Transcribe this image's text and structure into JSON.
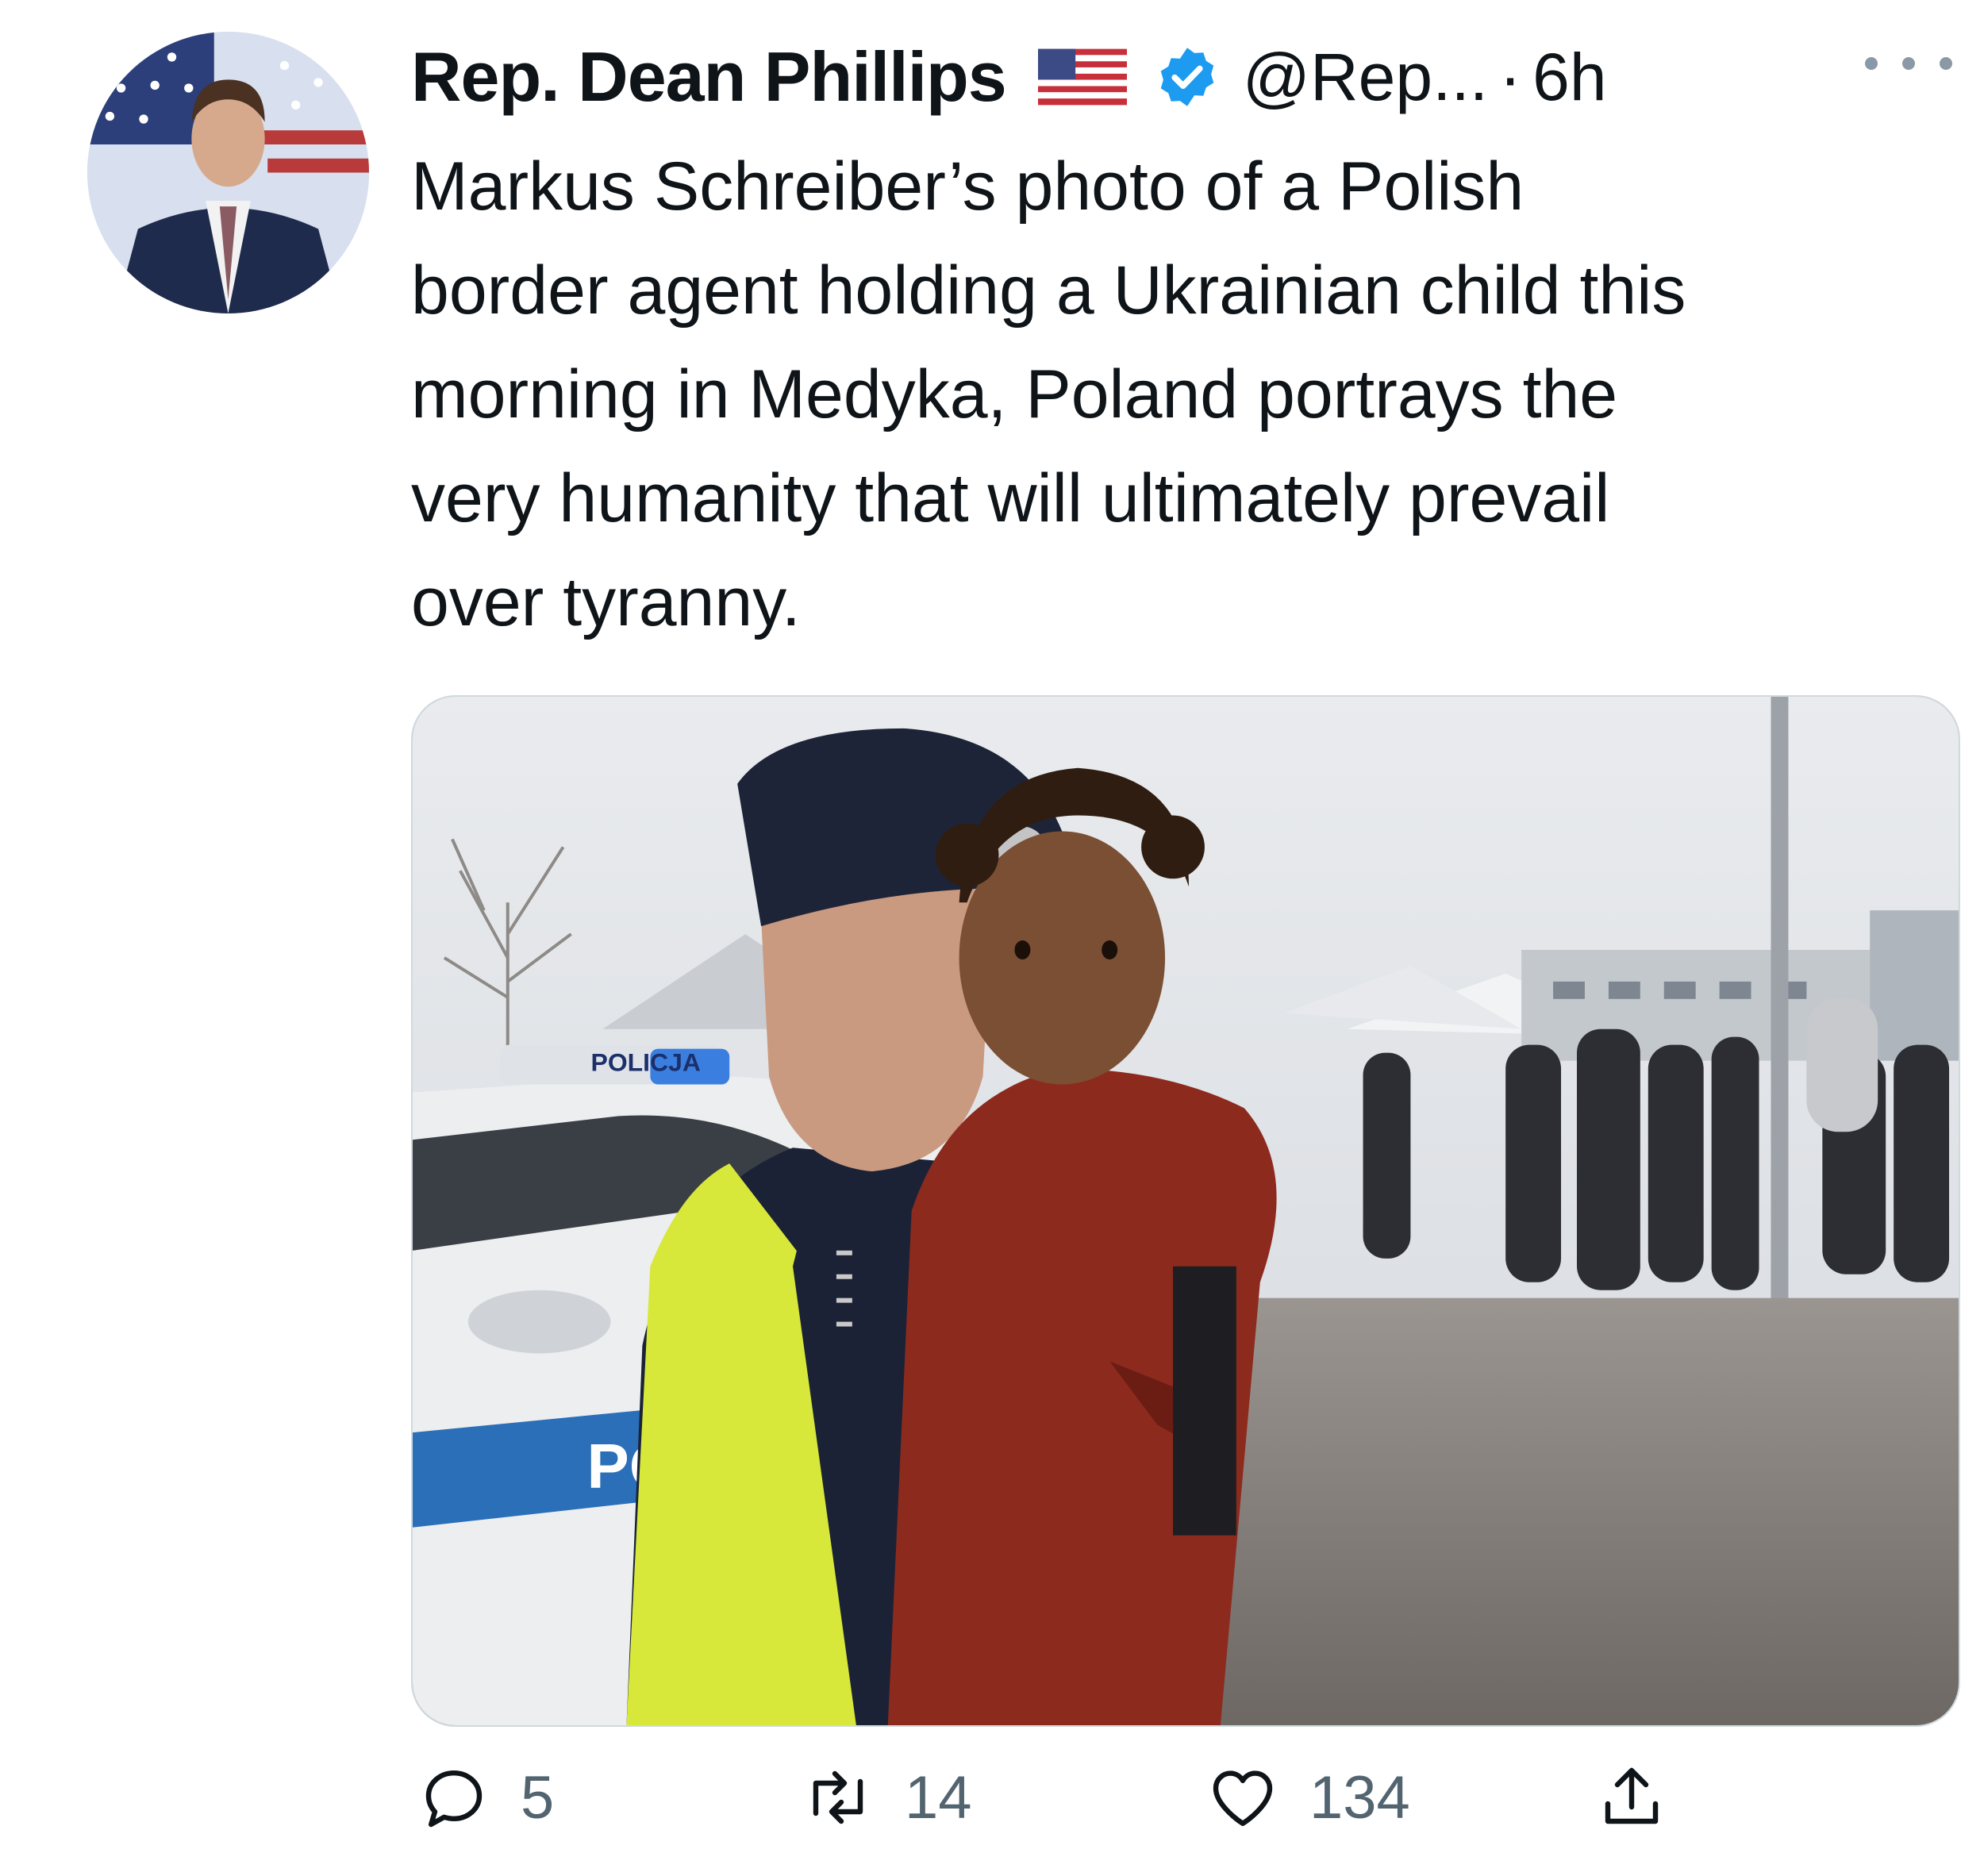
{
  "author": {
    "display_name": "Rep. Dean Phillips",
    "flag_icon": "us-flag-icon",
    "verified_icon": "verified-badge-icon",
    "handle": "@Rep...",
    "separator": "·",
    "time": "6h"
  },
  "tweet": {
    "text": "Markus Schreiber’s photo of a Polish\nborder agent holding a Ukrainian child this\nmorning in Medyka, Poland portrays the\nvery humanity that will ultimately prevail\nover tyranny."
  },
  "media": {
    "car_text_roof": "POLICJA",
    "car_text_side": "PO"
  },
  "actions": {
    "reply_count": "5",
    "retweet_count": "14",
    "like_count": "134"
  },
  "colors": {
    "verified": "#1d9bf0",
    "muted": "#536471",
    "text": "#0f1419"
  }
}
